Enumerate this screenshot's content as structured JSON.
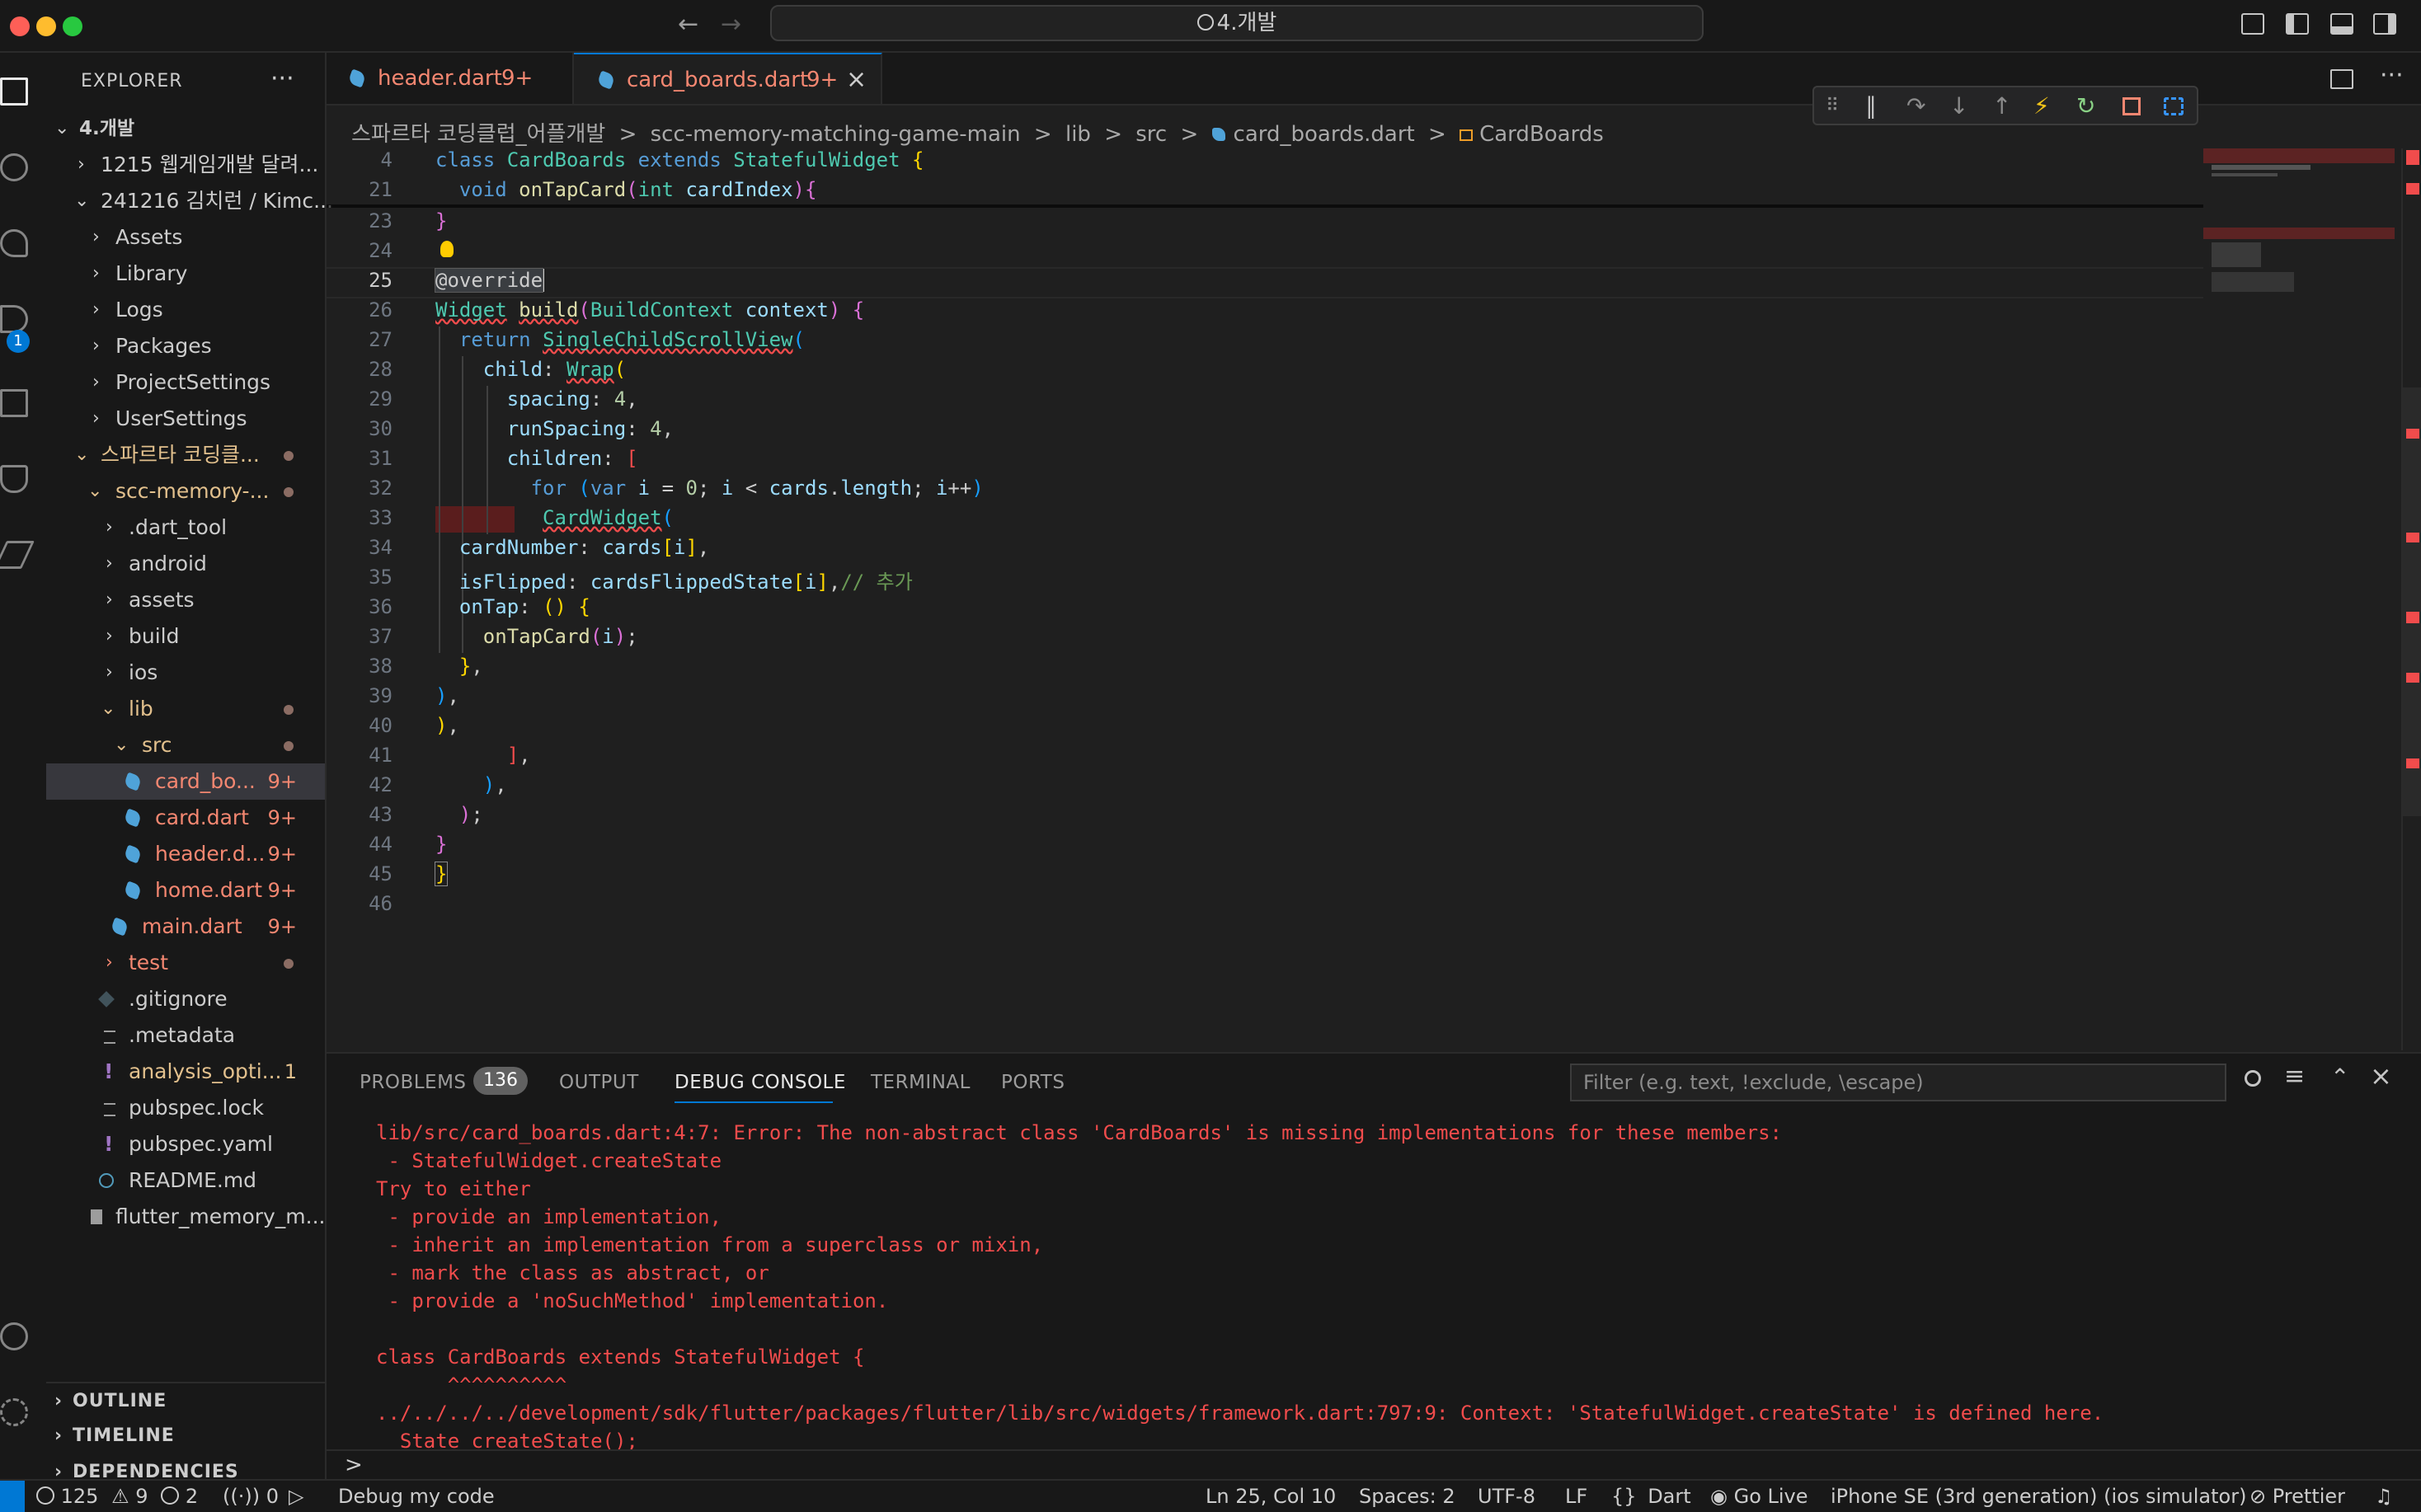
{
  "window": {
    "title": "4.개발"
  },
  "explorer": {
    "title": "EXPLORER",
    "more": "···",
    "items": [
      {
        "label": "4.개발",
        "badge": "",
        "kind": "root"
      },
      {
        "label": "1215 웹게임개발 달려...",
        "badge": ""
      },
      {
        "label": "241216 김치런 / Kimc...",
        "badge": ""
      },
      {
        "label": "Assets",
        "badge": ""
      },
      {
        "label": "Library",
        "badge": ""
      },
      {
        "label": "Logs",
        "badge": ""
      },
      {
        "label": "Packages",
        "badge": ""
      },
      {
        "label": "ProjectSettings",
        "badge": ""
      },
      {
        "label": "UserSettings",
        "badge": ""
      },
      {
        "label": "스파르타 코딩클...",
        "badge": ""
      },
      {
        "label": "scc-memory-...",
        "badge": ""
      },
      {
        "label": ".dart_tool",
        "badge": ""
      },
      {
        "label": "android",
        "badge": ""
      },
      {
        "label": "assets",
        "badge": ""
      },
      {
        "label": "build",
        "badge": ""
      },
      {
        "label": "ios",
        "badge": ""
      },
      {
        "label": "lib",
        "badge": ""
      },
      {
        "label": "src",
        "badge": ""
      },
      {
        "label": "card_bo...",
        "badge": "9+"
      },
      {
        "label": "card.dart",
        "badge": "9+"
      },
      {
        "label": "header.d...",
        "badge": "9+"
      },
      {
        "label": "home.dart",
        "badge": "9+"
      },
      {
        "label": "main.dart",
        "badge": "9+"
      },
      {
        "label": "test",
        "badge": ""
      },
      {
        "label": ".gitignore",
        "badge": ""
      },
      {
        "label": ".metadata",
        "badge": ""
      },
      {
        "label": "analysis_opti...",
        "badge": "1"
      },
      {
        "label": "pubspec.lock",
        "badge": ""
      },
      {
        "label": "pubspec.yaml",
        "badge": ""
      },
      {
        "label": "README.md",
        "badge": ""
      },
      {
        "label": "flutter_memory_m...",
        "badge": ""
      }
    ],
    "sections": [
      "OUTLINE",
      "TIMELINE",
      "DEPENDENCIES"
    ],
    "activity_badge": "1"
  },
  "tabs": [
    {
      "label": "header.dart",
      "badge": "9+"
    },
    {
      "label": "card_boards.dart",
      "badge": "9+",
      "close": "×"
    }
  ],
  "breadcrumb": [
    "스파르타 코딩클럽_어플개발",
    "scc-memory-matching-game-main",
    "lib",
    "src",
    "card_boards.dart",
    "CardBoards"
  ],
  "breadcrumb_sep": ">",
  "editor": {
    "line_numbers": [
      "4",
      "21",
      "23",
      "24",
      "25",
      "26",
      "27",
      "28",
      "29",
      "30",
      "31",
      "32",
      "33",
      "34",
      "35",
      "36",
      "37",
      "38",
      "39",
      "40",
      "41",
      "42",
      "43",
      "44",
      "45",
      "46"
    ]
  },
  "panel": {
    "tabs": [
      "PROBLEMS",
      "OUTPUT",
      "DEBUG CONSOLE",
      "TERMINAL",
      "PORTS"
    ],
    "problems_count": "136",
    "filter_placeholder": "Filter (e.g. text, !exclude, \\escape)",
    "console": [
      "lib/src/card_boards.dart:4:7: Error: The non-abstract class 'CardBoards' is missing implementations for these members:",
      " - StatefulWidget.createState",
      "Try to either",
      " - provide an implementation,",
      " - inherit an implementation from a superclass or mixin,",
      " - mark the class as abstract, or",
      " - provide a 'noSuchMethod' implementation.",
      "",
      "class CardBoards extends StatefulWidget {",
      "      ^^^^^^^^^^",
      "../../../../development/sdk/flutter/packages/flutter/lib/src/widgets/framework.dart:797:9: Context: 'StatefulWidget.createState' is defined here.",
      "  State createState();"
    ],
    "prompt": ">"
  },
  "statusbar": {
    "errors": "125",
    "warnings": "9",
    "infos": "2",
    "ports": "0",
    "debug": "Debug my code",
    "cursor": "Ln 25, Col 10",
    "spaces": "Spaces: 2",
    "encoding": "UTF-8",
    "eol": "LF",
    "language": "Dart",
    "golive": "Go Live",
    "device": "iPhone SE (3rd generation) (ios simulator)",
    "prettier": "Prettier"
  },
  "colors": {
    "accent": "#0078d4",
    "error": "#f14c4c",
    "modified": "#e2c08d",
    "dart": "#4fa3d9"
  }
}
